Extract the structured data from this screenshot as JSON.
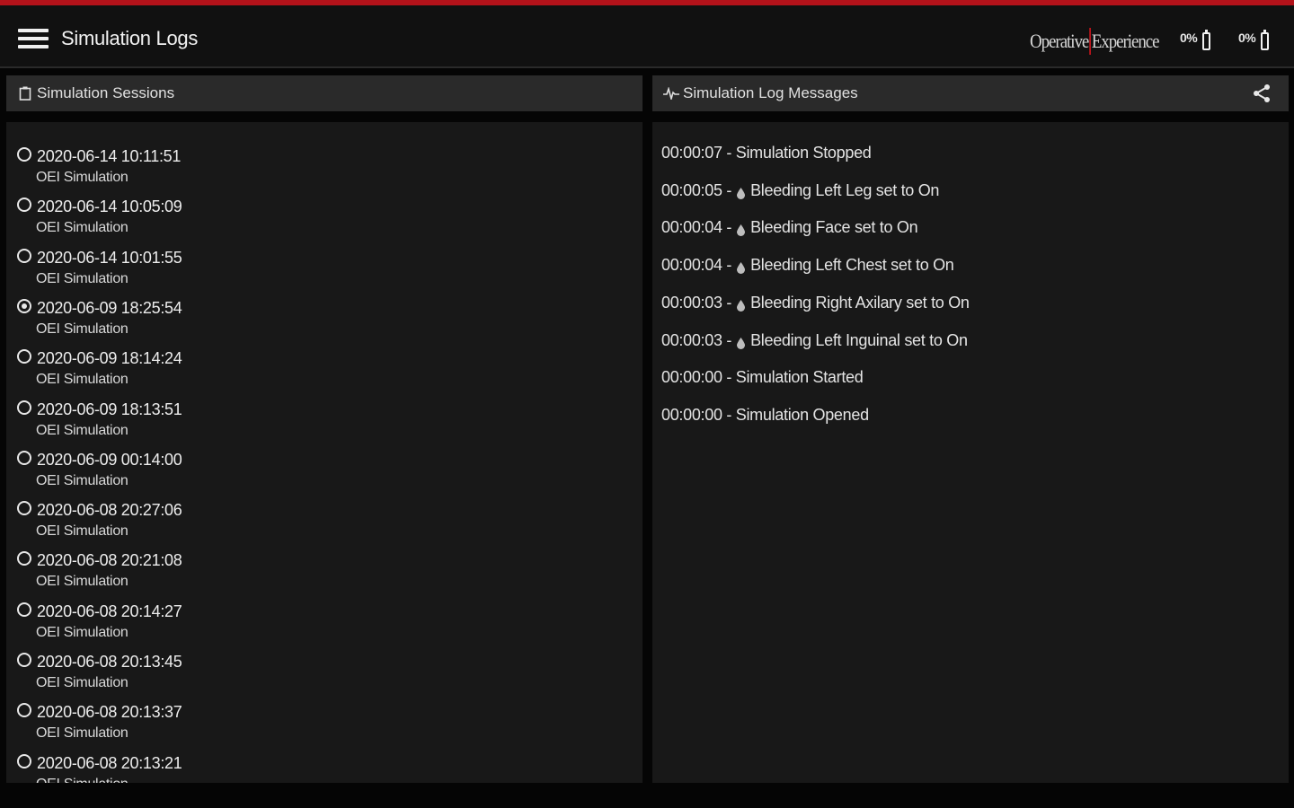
{
  "appbar": {
    "title": "Simulation Logs",
    "brand": {
      "left": "Operative",
      "right": "Experience"
    },
    "batteries": [
      {
        "label": "0%",
        "level": 0
      },
      {
        "label": "0%",
        "level": 0
      }
    ]
  },
  "sessions_panel": {
    "header": "Simulation Sessions",
    "items": [
      {
        "timestamp": "2020-06-14 10:11:51",
        "name": "OEI Simulation",
        "selected": false
      },
      {
        "timestamp": "2020-06-14 10:05:09",
        "name": "OEI Simulation",
        "selected": false
      },
      {
        "timestamp": "2020-06-14 10:01:55",
        "name": "OEI Simulation",
        "selected": false
      },
      {
        "timestamp": "2020-06-09 18:25:54",
        "name": "OEI Simulation",
        "selected": true
      },
      {
        "timestamp": "2020-06-09 18:14:24",
        "name": "OEI Simulation",
        "selected": false
      },
      {
        "timestamp": "2020-06-09 18:13:51",
        "name": "OEI Simulation",
        "selected": false
      },
      {
        "timestamp": "2020-06-09 00:14:00",
        "name": "OEI Simulation",
        "selected": false
      },
      {
        "timestamp": "2020-06-08 20:27:06",
        "name": "OEI Simulation",
        "selected": false
      },
      {
        "timestamp": "2020-06-08 20:21:08",
        "name": "OEI Simulation",
        "selected": false
      },
      {
        "timestamp": "2020-06-08 20:14:27",
        "name": "OEI Simulation",
        "selected": false
      },
      {
        "timestamp": "2020-06-08 20:13:45",
        "name": "OEI Simulation",
        "selected": false
      },
      {
        "timestamp": "2020-06-08 20:13:37",
        "name": "OEI Simulation",
        "selected": false
      },
      {
        "timestamp": "2020-06-08 20:13:21",
        "name": "OEI Simulation",
        "selected": false
      }
    ]
  },
  "messages_panel": {
    "header": "Simulation Log Messages",
    "messages": [
      {
        "time": "00:00:07",
        "text": "Simulation Stopped",
        "icon": ""
      },
      {
        "time": "00:00:05",
        "text": "Bleeding Left Leg set to On",
        "icon": "blood-drop-icon"
      },
      {
        "time": "00:00:04",
        "text": "Bleeding Face set to On",
        "icon": "blood-drop-icon"
      },
      {
        "time": "00:00:04",
        "text": "Bleeding Left Chest set to On",
        "icon": "blood-drop-icon"
      },
      {
        "time": "00:00:03",
        "text": "Bleeding Right Axilary set to On",
        "icon": "blood-drop-icon"
      },
      {
        "time": "00:00:03",
        "text": "Bleeding Left Inguinal set to On",
        "icon": "blood-drop-icon"
      },
      {
        "time": "00:00:00",
        "text": "Simulation Started",
        "icon": ""
      },
      {
        "time": "00:00:00",
        "text": "Simulation Opened",
        "icon": ""
      }
    ]
  },
  "colors": {
    "accent": "#b3121a",
    "background": "#181818",
    "panel_header": "#2a2a2a"
  }
}
